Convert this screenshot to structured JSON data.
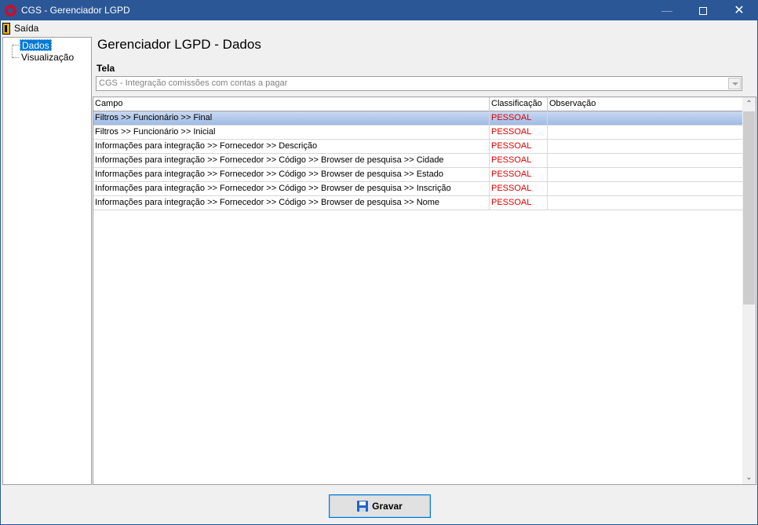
{
  "window": {
    "title": "CGS - Gerenciador LGPD"
  },
  "menu": {
    "items": [
      {
        "label": "Saída",
        "icon": "exit-door-icon"
      }
    ]
  },
  "tree": {
    "items": [
      {
        "label": "Dados",
        "selected": true
      },
      {
        "label": "Visualização",
        "selected": false
      }
    ]
  },
  "main": {
    "title": "Gerenciador LGPD - Dados",
    "tela_label": "Tela",
    "tela_value": "CGS - Integração comissões com contas a pagar"
  },
  "grid": {
    "columns": [
      "Campo",
      "Classificação",
      "Observação"
    ],
    "rows": [
      {
        "campo": "Filtros >> Funcionário >> Final",
        "classificacao": "PESSOAL",
        "observacao": "",
        "selected": true
      },
      {
        "campo": "Filtros >> Funcionário >> Inicial",
        "classificacao": "PESSOAL",
        "observacao": ""
      },
      {
        "campo": "Informações para integração >> Fornecedor  >> Descrição",
        "classificacao": "PESSOAL",
        "observacao": ""
      },
      {
        "campo": "Informações para integração >> Fornecedor >> Código >> Browser de pesquisa >> Cidade",
        "classificacao": "PESSOAL",
        "observacao": ""
      },
      {
        "campo": "Informações para integração >> Fornecedor >> Código >> Browser de pesquisa >> Estado",
        "classificacao": "PESSOAL",
        "observacao": ""
      },
      {
        "campo": "Informações para integração >> Fornecedor >> Código >> Browser de pesquisa >> Inscrição",
        "classificacao": "PESSOAL",
        "observacao": ""
      },
      {
        "campo": "Informações para integração >> Fornecedor >> Código >> Browser de pesquisa >> Nome",
        "classificacao": "PESSOAL",
        "observacao": ""
      }
    ]
  },
  "footer": {
    "save_label": "Gravar",
    "save_icon": "floppy-disk-icon"
  },
  "colors": {
    "titlebar": "#2b5797",
    "selection": "#0078d7",
    "classification_text": "#e00000",
    "selected_row": "#b4cbee"
  }
}
